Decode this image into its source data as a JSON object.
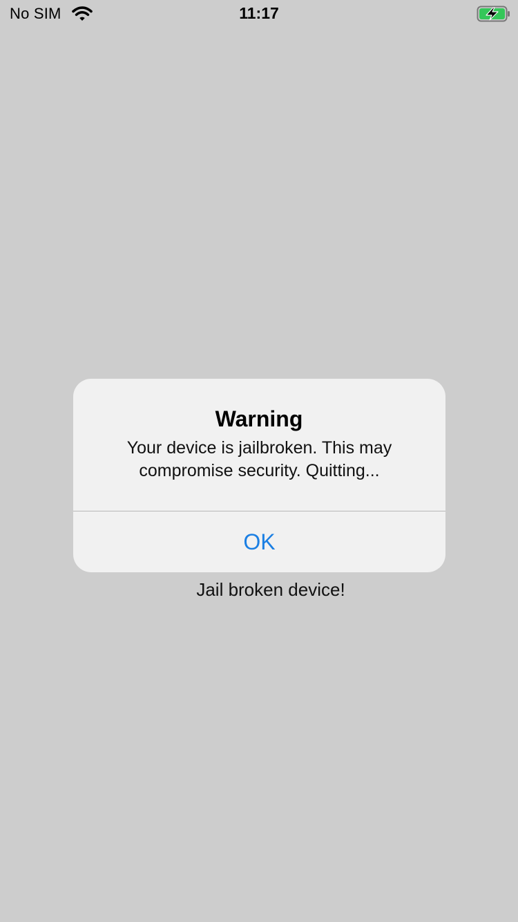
{
  "status_bar": {
    "carrier": "No SIM",
    "time": "11:17",
    "wifi_icon": "wifi-icon",
    "battery_icon": "charging-battery-icon",
    "battery_color": "#34c759"
  },
  "screen": {
    "message": "Jail broken device!"
  },
  "alert": {
    "title": "Warning",
    "message": "Your device is jailbroken. This may compromise security. Quitting...",
    "button_label": "OK",
    "button_color": "#1b7fe3"
  }
}
